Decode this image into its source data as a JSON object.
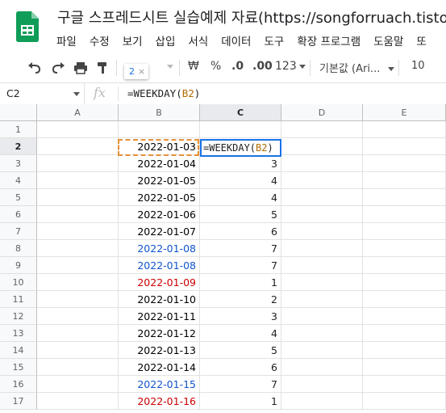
{
  "app": {
    "title": "구글 스프레드시트 실습예제 자료(https://songforruach.tistor",
    "logo_icon": "google-sheets-icon"
  },
  "menu": [
    "파일",
    "수정",
    "보기",
    "삽입",
    "서식",
    "데이터",
    "도구",
    "확장 프로그램",
    "도움말",
    "또"
  ],
  "toolbar": {
    "undo_icon": "undo-icon",
    "redo_icon": "redo-icon",
    "print_icon": "print-icon",
    "paint_icon": "paint-format-icon",
    "currency": "₩",
    "percent": "%",
    "decrease_decimal": ".0",
    "increase_decimal": ".00",
    "more_formats": "123",
    "font": "기본값 (Ari...",
    "font_size": "10"
  },
  "tooltip": {
    "text": "2",
    "close": "×"
  },
  "formula_bar": {
    "cell_ref": "C2",
    "fx": "fx",
    "formula_prefix": "=WEEKDAY(",
    "formula_ref": "B2",
    "formula_suffix": ")"
  },
  "columns": [
    "A",
    "B",
    "C",
    "D",
    "E"
  ],
  "rows": [
    {
      "n": "1",
      "date": "",
      "weekday": "",
      "kind": ""
    },
    {
      "n": "2",
      "date": "2022-01-03",
      "weekday": "",
      "kind": ""
    },
    {
      "n": "3",
      "date": "2022-01-04",
      "weekday": "3",
      "kind": ""
    },
    {
      "n": "4",
      "date": "2022-01-05",
      "weekday": "4",
      "kind": ""
    },
    {
      "n": "5",
      "date": "2022-01-05",
      "weekday": "4",
      "kind": ""
    },
    {
      "n": "6",
      "date": "2022-01-06",
      "weekday": "5",
      "kind": ""
    },
    {
      "n": "7",
      "date": "2022-01-07",
      "weekday": "6",
      "kind": ""
    },
    {
      "n": "8",
      "date": "2022-01-08",
      "weekday": "7",
      "kind": "sat"
    },
    {
      "n": "9",
      "date": "2022-01-08",
      "weekday": "7",
      "kind": "sat"
    },
    {
      "n": "10",
      "date": "2022-01-09",
      "weekday": "1",
      "kind": "sun"
    },
    {
      "n": "11",
      "date": "2022-01-10",
      "weekday": "2",
      "kind": ""
    },
    {
      "n": "12",
      "date": "2022-01-11",
      "weekday": "3",
      "kind": ""
    },
    {
      "n": "13",
      "date": "2022-01-12",
      "weekday": "4",
      "kind": ""
    },
    {
      "n": "14",
      "date": "2022-01-13",
      "weekday": "5",
      "kind": ""
    },
    {
      "n": "15",
      "date": "2022-01-14",
      "weekday": "6",
      "kind": ""
    },
    {
      "n": "16",
      "date": "2022-01-15",
      "weekday": "7",
      "kind": "sat"
    },
    {
      "n": "17",
      "date": "2022-01-16",
      "weekday": "1",
      "kind": "sun"
    }
  ],
  "active_cell": {
    "prefix": "=WEEKDAY(",
    "ref": "B2",
    "suffix": ")"
  },
  "colors": {
    "saturday": "#1155cc",
    "sunday": "#cc0000",
    "selection": "#1a73e8",
    "ref_highlight": "#e69138"
  }
}
